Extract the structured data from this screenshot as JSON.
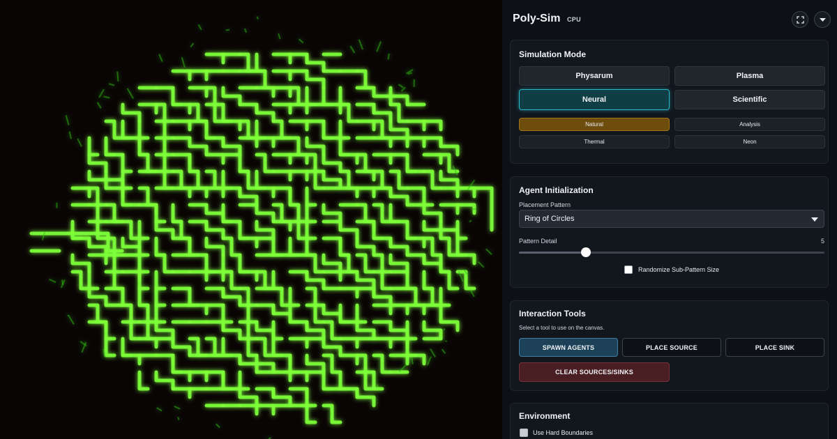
{
  "app": {
    "title": "Poly-Sim",
    "backend": "CPU",
    "fullscreen_icon": "fullscreen-icon",
    "menu_icon": "chevron-down-icon"
  },
  "simulation_mode": {
    "title": "Simulation Mode",
    "modes": [
      {
        "label": "Physarum",
        "active": false
      },
      {
        "label": "Plasma",
        "active": false
      },
      {
        "label": "Neural",
        "active": true
      },
      {
        "label": "Scientific",
        "active": false
      }
    ],
    "themes": [
      {
        "label": "Natural",
        "active": true
      },
      {
        "label": "Analysis",
        "active": false
      },
      {
        "label": "Thermal",
        "active": false
      },
      {
        "label": "Neon",
        "active": false
      }
    ]
  },
  "agent_init": {
    "title": "Agent Initialization",
    "pattern_label": "Placement Pattern",
    "pattern_value": "Ring of Circles",
    "detail_label": "Pattern Detail",
    "detail_value": "5",
    "detail_fraction": 0.22,
    "randomize_label": "Randomize Sub-Pattern Size",
    "randomize_checked": false
  },
  "interaction_tools": {
    "title": "Interaction Tools",
    "hint": "Select a tool to use on the canvas.",
    "spawn_label": "SPAWN AGENTS",
    "source_label": "PLACE SOURCE",
    "sink_label": "PLACE SINK",
    "clear_label": "CLEAR SOURCES/SINKS",
    "active_tool": "spawn"
  },
  "environment": {
    "title": "Environment",
    "hard_boundaries_label": "Use Hard Boundaries",
    "hard_boundaries_checked": false
  },
  "colors": {
    "trail": "#7dff3a",
    "trail_glow": "#2fbf16",
    "background": "#0a0505",
    "accent_active": "#2bb7c4",
    "theme_active": "#6e4d0c"
  }
}
